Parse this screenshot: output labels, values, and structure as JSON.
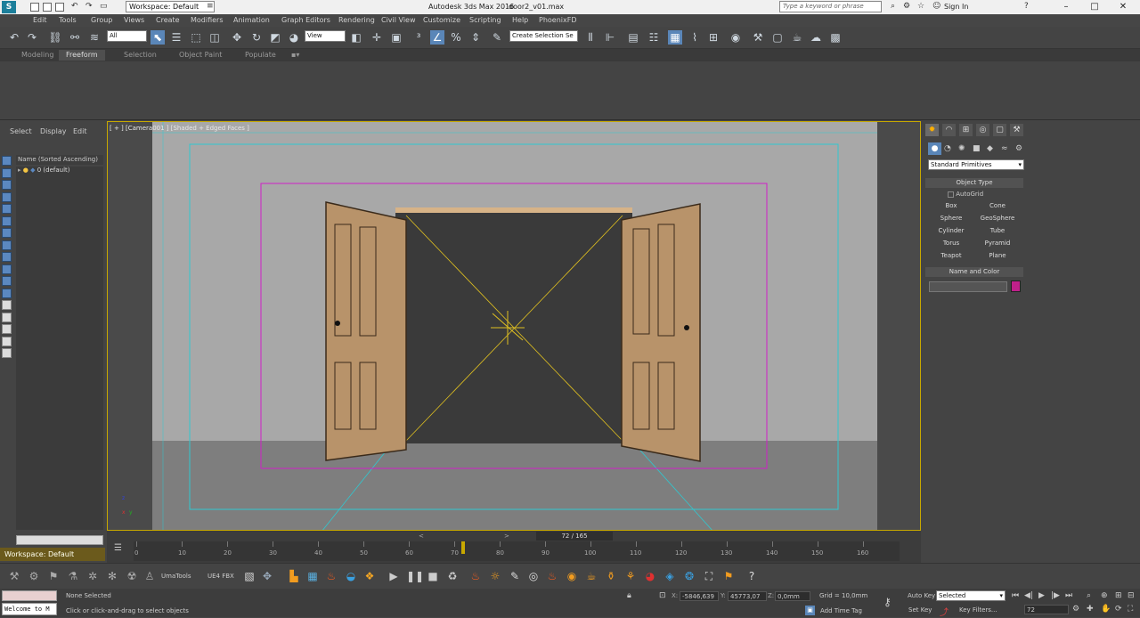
{
  "window": {
    "title": "Autodesk 3ds Max 2016",
    "file": "door2_v01.max",
    "workspace": "Workspace: Default",
    "search_placeholder": "Type a keyword or phrase",
    "sign_in": "Sign In"
  },
  "menu": [
    "Edit",
    "Tools",
    "Group",
    "Views",
    "Create",
    "Modifiers",
    "Animation",
    "Graph Editors",
    "Rendering",
    "Civil View",
    "Customize",
    "Scripting",
    "Help",
    "PhoenixFD"
  ],
  "toolbar": {
    "selection_filter": "All",
    "ref_coord": "View",
    "named_selection": "Create Selection Se"
  },
  "ribbon": {
    "tabs": [
      "Modeling",
      "Freeform",
      "Selection",
      "Object Paint",
      "Populate"
    ],
    "active": "Freeform"
  },
  "scene_explorer": {
    "tabs": [
      "Select",
      "Display",
      "Edit"
    ],
    "header": "Name (Sorted Ascending)",
    "rows": [
      "0 (default)"
    ]
  },
  "viewport": {
    "label": "[ + ] [Camera001 ] [Shaded + Edged Faces ]"
  },
  "command_panel": {
    "category": "Standard Primitives",
    "object_type_title": "Object Type",
    "autogrid": "AutoGrid",
    "primitives": [
      "Box",
      "Cone",
      "Sphere",
      "GeoSphere",
      "Cylinder",
      "Tube",
      "Torus",
      "Pyramid",
      "Teapot",
      "Plane"
    ],
    "name_color_title": "Name and Color",
    "color": "#c0208a"
  },
  "timeline": {
    "slider_label": "72 / 165",
    "ticks": [
      "0",
      "10",
      "20",
      "30",
      "40",
      "50",
      "60",
      "70",
      "80",
      "90",
      "100",
      "110",
      "120",
      "130",
      "140",
      "150",
      "160"
    ],
    "current_frame": 72,
    "total_frames": 165
  },
  "bottom_toolbar": {
    "uma_tools": "UmaTools",
    "ue4_fbx": "UE4 FBX"
  },
  "status": {
    "maxscript": "Welcome to M",
    "selection": "None Selected",
    "prompt": "Click or click-and-drag to select objects",
    "x": "-5846,639",
    "y": "45773,07",
    "z": "0,0mm",
    "grid": "Grid = 10,0mm",
    "add_time_tag": "Add Time Tag",
    "auto_key": "Auto Key",
    "selected": "Selected",
    "set_key": "Set Key",
    "key_filters": "Key Filters...",
    "frame": "72"
  }
}
